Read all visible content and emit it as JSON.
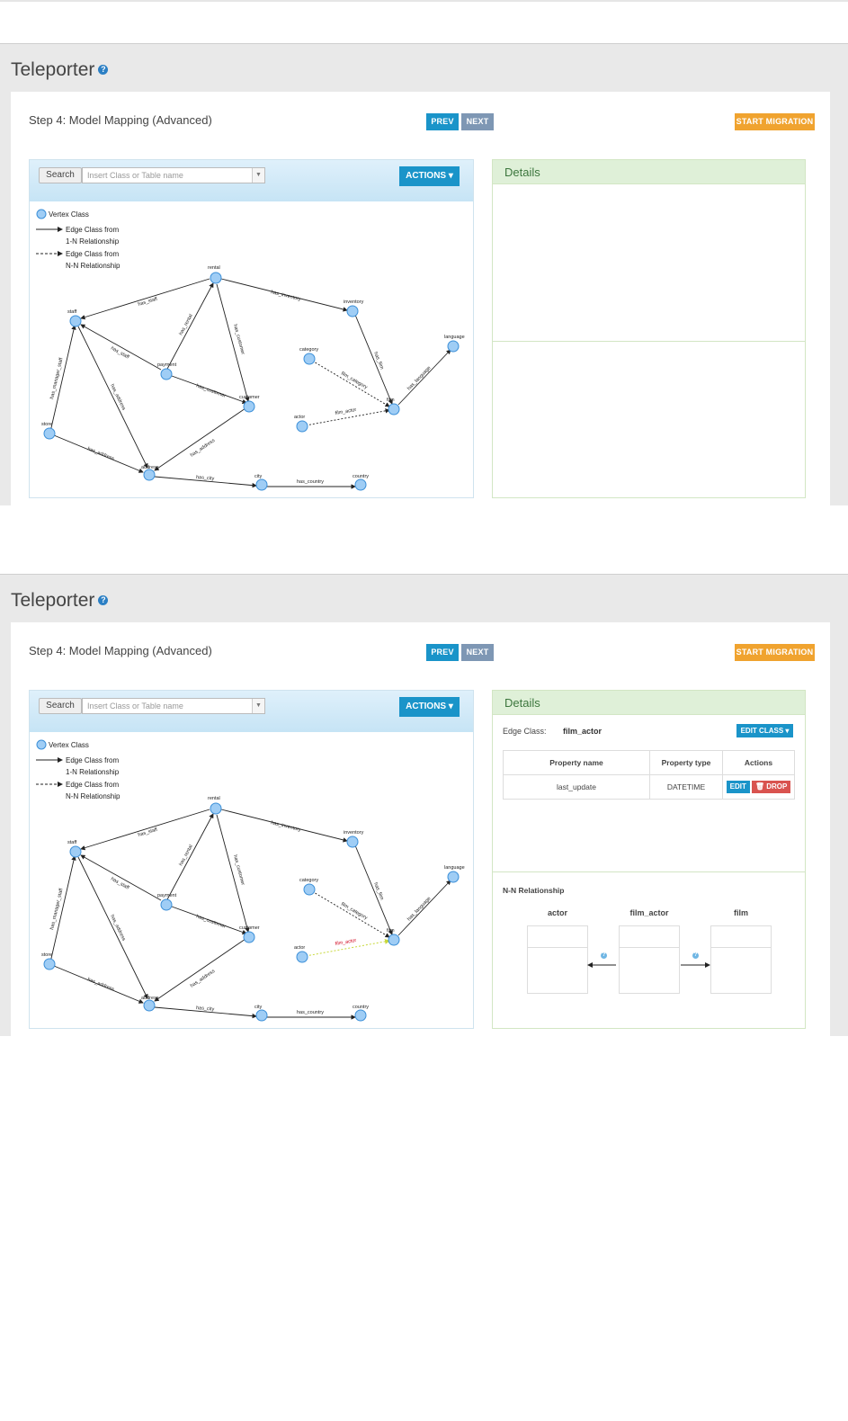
{
  "app": {
    "title": "Teleporter",
    "step_label": "Step 4: Model Mapping (Advanced)",
    "prev_label": "PREV",
    "next_label": "NEXT",
    "start_label": "START MIGRATION",
    "search_label": "Search",
    "search_placeholder": "Insert Class or Table name",
    "actions_label": "ACTIONS",
    "details_title": "Details"
  },
  "legend": {
    "vertex": "Vertex Class",
    "edge_1n_line1": "Edge Class from",
    "edge_1n_line2": "1-N Relationship",
    "edge_nn_line1": "Edge Class from",
    "edge_nn_line2": "N-N Relationship"
  },
  "graph": {
    "nodes": [
      "rental",
      "inventory",
      "staff",
      "payment",
      "category",
      "language",
      "customer",
      "film",
      "store",
      "actor",
      "address",
      "city",
      "country"
    ],
    "edges": [
      "has_staff",
      "has_inventory",
      "has_rental",
      "has_customer",
      "has_manager_staff",
      "has_staff",
      "has_address",
      "has_customer",
      "has_film",
      "has_language",
      "film_category",
      "film_actor",
      "has_address",
      "has_address",
      "has_city",
      "has_country"
    ]
  },
  "details": {
    "edge_class_label": "Edge Class:",
    "edge_class_value": "film_actor",
    "edit_class_label": "EDIT CLASS",
    "columns": [
      "Property name",
      "Property type",
      "Actions"
    ],
    "rows": [
      {
        "name": "last_update",
        "type": "DATETIME"
      }
    ],
    "edit_label": "EDIT",
    "drop_label": "DROP",
    "nn_title": "N-N Relationship",
    "nn_from": "actor",
    "nn_mid": "film_actor",
    "nn_to": "film"
  },
  "colors": {
    "primary": "#1a94c9",
    "secondary": "#7e97b4",
    "warning": "#f0a32f",
    "danger": "#d9534f",
    "node": "#9fcdf5",
    "node_stroke": "#3b8fd8",
    "highlight_edge": "#d8e84a",
    "highlight_label": "#d0021b"
  }
}
